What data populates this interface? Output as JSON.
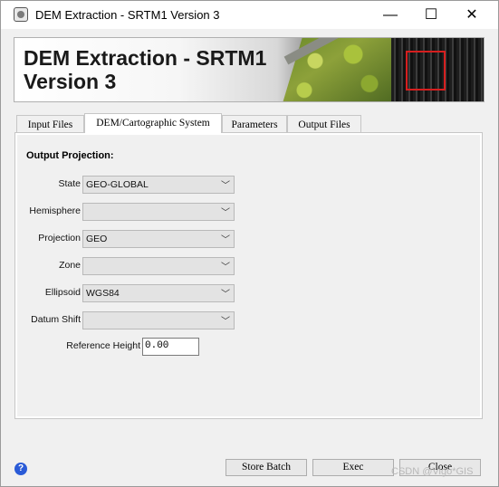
{
  "window": {
    "title": "DEM Extraction - SRTM1 Version 3",
    "controls": {
      "minimize": "—",
      "maximize": "☐",
      "close": "✕"
    }
  },
  "banner": {
    "title_line1": "DEM Extraction - SRTM1",
    "title_line2": "Version 3"
  },
  "tabs": [
    {
      "label": "Input Files",
      "active": false
    },
    {
      "label": "DEM/Cartographic System",
      "active": true
    },
    {
      "label": "Parameters",
      "active": false
    },
    {
      "label": "Output Files",
      "active": false
    }
  ],
  "panel": {
    "section_title": "Output Projection:",
    "fields": [
      {
        "label": "State",
        "value": "GEO-GLOBAL"
      },
      {
        "label": "Hemisphere",
        "value": ""
      },
      {
        "label": "Projection",
        "value": "GEO"
      },
      {
        "label": "Zone",
        "value": ""
      },
      {
        "label": "Ellipsoid",
        "value": "WGS84"
      },
      {
        "label": "Datum Shift",
        "value": ""
      }
    ],
    "reference_height": {
      "label": "Reference Height",
      "value": "0.00"
    }
  },
  "footer": {
    "help_icon": "?",
    "store_batch": "Store Batch",
    "exec": "Exec",
    "close": "Close",
    "watermark": "CSDN @Vigo*GIS"
  }
}
